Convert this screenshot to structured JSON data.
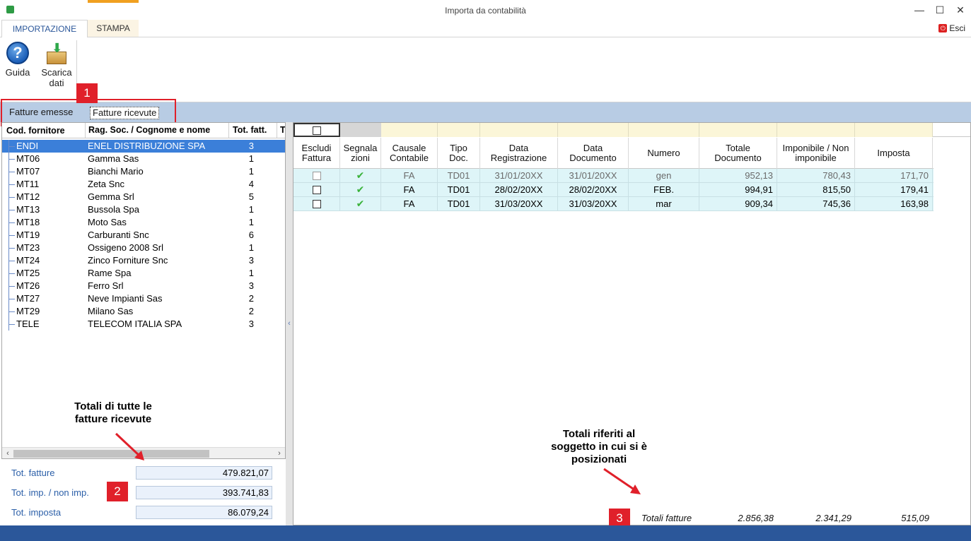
{
  "window": {
    "title": "Importa da contabilità",
    "minimize": "—",
    "maximize": "☐",
    "close": "✕"
  },
  "ribbon": {
    "tabs": [
      {
        "label": "IMPORTAZIONE"
      },
      {
        "label": "STAMPA"
      }
    ],
    "esci": "Esci",
    "buttons": {
      "guida": "Guida",
      "scarica_line1": "Scarica",
      "scarica_line2": "dati"
    }
  },
  "subtabs": {
    "emesse": "Fatture emesse",
    "ricevute": "Fatture ricevute"
  },
  "badges": {
    "b1": "1",
    "b2": "2",
    "b3": "3"
  },
  "left_table": {
    "headers": [
      "Cod. fornitore",
      "Rag. Soc. / Cognome e nome",
      "Tot. fatt.",
      "T"
    ],
    "rows": [
      {
        "code": "ENDI",
        "name": "ENEL DISTRIBUZIONE SPA",
        "tot": "3"
      },
      {
        "code": "MT06",
        "name": "Gamma Sas",
        "tot": "1"
      },
      {
        "code": "MT07",
        "name": "Bianchi Mario",
        "tot": "1"
      },
      {
        "code": "MT11",
        "name": "Zeta Snc",
        "tot": "4"
      },
      {
        "code": "MT12",
        "name": "Gemma Srl",
        "tot": "5"
      },
      {
        "code": "MT13",
        "name": "Bussola Spa",
        "tot": "1"
      },
      {
        "code": "MT18",
        "name": "Moto Sas",
        "tot": "1"
      },
      {
        "code": "MT19",
        "name": "Carburanti Snc",
        "tot": "6"
      },
      {
        "code": "MT23",
        "name": "Ossigeno 2008 Srl",
        "tot": "1"
      },
      {
        "code": "MT24",
        "name": "Zinco Forniture Snc",
        "tot": "3"
      },
      {
        "code": "MT25",
        "name": "Rame Spa",
        "tot": "1"
      },
      {
        "code": "MT26",
        "name": "Ferro Srl",
        "tot": "3"
      },
      {
        "code": "MT27",
        "name": "Neve Impianti Sas",
        "tot": "2"
      },
      {
        "code": "MT29",
        "name": "Milano Sas",
        "tot": "2"
      },
      {
        "code": "TELE",
        "name": "TELECOM ITALIA SPA",
        "tot": "3"
      }
    ]
  },
  "left_totals": {
    "fatture_label": "Tot. fatture",
    "fatture": "479.821,07",
    "imp_label": "Tot. imp. / non imp.",
    "imp": "393.741,83",
    "imposta_label": "Tot. imposta",
    "imposta": "86.079,24"
  },
  "right_table": {
    "headers": {
      "escludi": [
        "Escludi",
        "Fattura"
      ],
      "segnala": [
        "Segnala",
        "zioni"
      ],
      "causale": [
        "Causale",
        "Contabile"
      ],
      "tipo": [
        "Tipo",
        "Doc."
      ],
      "data_reg": [
        "Data",
        "Registrazione"
      ],
      "data_doc": [
        "Data",
        "Documento"
      ],
      "numero": [
        "Numero"
      ],
      "totale": [
        "Totale",
        "Documento"
      ],
      "imponibile": [
        "Imponibile / Non",
        "imponibile"
      ],
      "imposta": [
        "Imposta"
      ]
    },
    "check_glyph": "✔",
    "rows": [
      {
        "causale": "FA",
        "tipo": "TD01",
        "data_reg": "31/01/20XX",
        "data_doc": "31/01/20XX",
        "numero": "gen",
        "totale": "952,13",
        "imponibile": "780,43",
        "imposta": "171,70"
      },
      {
        "causale": "FA",
        "tipo": "TD01",
        "data_reg": "28/02/20XX",
        "data_doc": "28/02/20XX",
        "numero": "FEB.",
        "totale": "994,91",
        "imponibile": "815,50",
        "imposta": "179,41"
      },
      {
        "causale": "FA",
        "tipo": "TD01",
        "data_reg": "31/03/20XX",
        "data_doc": "31/03/20XX",
        "numero": "mar",
        "totale": "909,34",
        "imponibile": "745,36",
        "imposta": "163,98"
      }
    ],
    "totals": {
      "label": "Totali fatture",
      "totale": "2.856,38",
      "imponibile": "2.341,29",
      "imposta": "515,09"
    }
  },
  "annotations": {
    "left_l1": "Totali di tutte le",
    "left_l2": "fatture ricevute",
    "right_l1": "Totali riferiti al",
    "right_l2": "soggetto in cui si è",
    "right_l3": "posizionati"
  },
  "colors": {
    "accent": "#2b579a",
    "selection": "#3b7fd9",
    "highlight_red": "#e0202a",
    "row_bg": "#def5f8"
  }
}
